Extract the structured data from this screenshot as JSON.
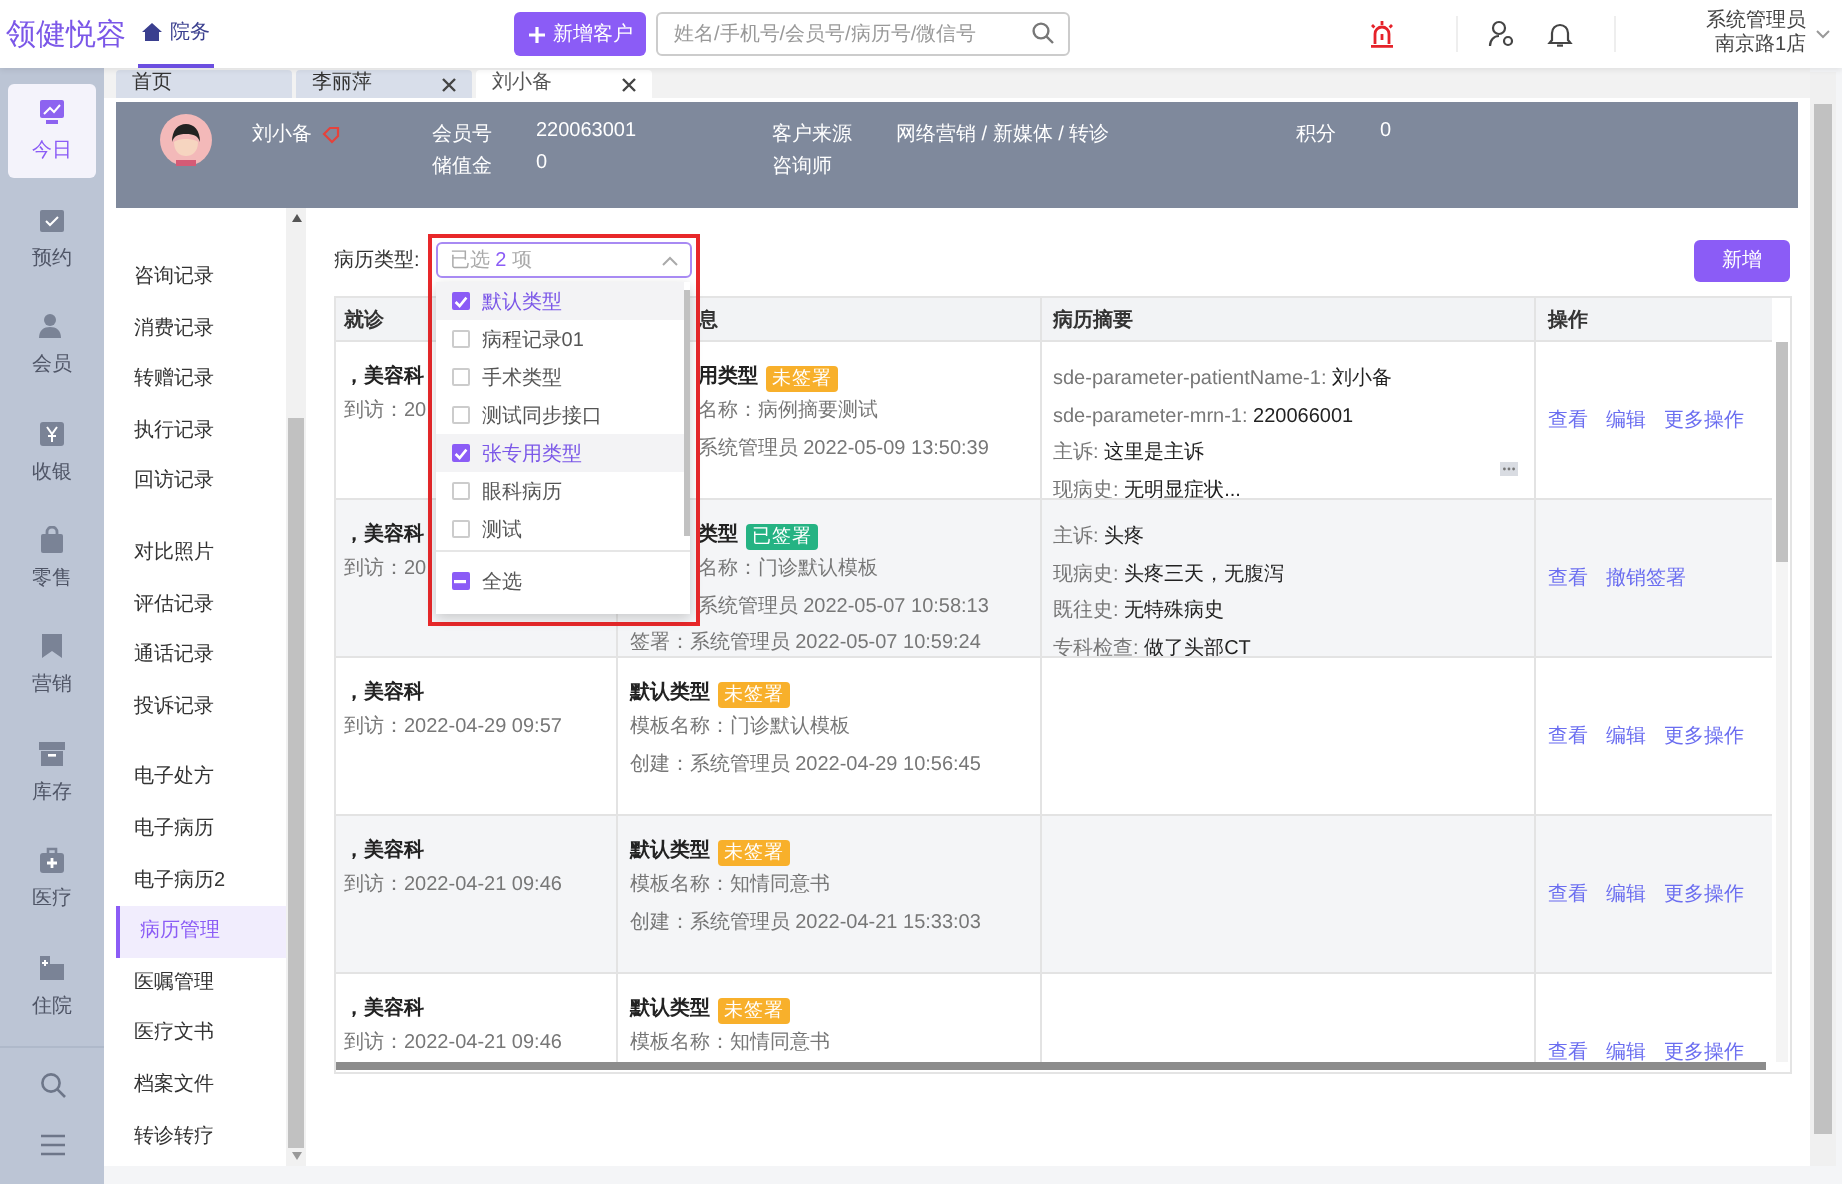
{
  "app": {
    "logo": "领健悦容",
    "section": "院务",
    "add_button": "新增客户",
    "search_placeholder": "姓名/手机号/会员号/病历号/微信号",
    "user": "系统管理员",
    "store": "南京路1店"
  },
  "nav": [
    {
      "label": "今日",
      "selected": true
    },
    {
      "label": "预约",
      "selected": false
    },
    {
      "label": "会员",
      "selected": false
    },
    {
      "label": "收银",
      "selected": false
    },
    {
      "label": "零售",
      "selected": false
    },
    {
      "label": "营销",
      "selected": false
    },
    {
      "label": "库存",
      "selected": false
    },
    {
      "label": "医疗",
      "selected": false
    },
    {
      "label": "住院",
      "selected": false
    }
  ],
  "tabs": [
    {
      "label": "首页",
      "selected": false,
      "closable": false
    },
    {
      "label": "李丽萍",
      "selected": false,
      "closable": true
    },
    {
      "label": "刘小备",
      "selected": true,
      "closable": true
    }
  ],
  "patient": {
    "name": "刘小备",
    "fields": [
      {
        "label": "会员号",
        "value": "220063001"
      },
      {
        "label": "储值金",
        "value": "0"
      },
      {
        "label": "客户来源",
        "value": "网络营销 / 新媒体 / 转诊"
      },
      {
        "label": "咨询师"
      },
      {
        "label": "积分",
        "value": "0"
      }
    ]
  },
  "submenu": [
    {
      "items": [
        {
          "label": "咨询记录",
          "selected": false
        },
        {
          "label": "消费记录",
          "selected": false
        },
        {
          "label": "转赠记录",
          "selected": false
        },
        {
          "label": "执行记录",
          "selected": false
        },
        {
          "label": "回访记录",
          "selected": false
        }
      ]
    },
    {
      "items": [
        {
          "label": "对比照片",
          "selected": false
        },
        {
          "label": "评估记录",
          "selected": false
        },
        {
          "label": "通话记录",
          "selected": false
        },
        {
          "label": "投诉记录",
          "selected": false
        }
      ]
    },
    {
      "items": [
        {
          "label": "电子处方",
          "selected": false
        },
        {
          "label": "电子病历",
          "selected": false
        },
        {
          "label": "电子病历2",
          "selected": false
        },
        {
          "label": "病历管理",
          "selected": true
        },
        {
          "label": "医嘱管理",
          "selected": false
        },
        {
          "label": "医疗文书",
          "selected": false
        },
        {
          "label": "档案文件",
          "selected": false
        },
        {
          "label": "转诊转疗",
          "selected": false
        }
      ]
    }
  ],
  "filter": {
    "label": "病历类型:",
    "summary_prefix": "已选",
    "count": "2",
    "summary_suffix": "项",
    "open": true,
    "highlighted": true,
    "options": [
      {
        "label": "默认类型",
        "checked": true,
        "hovered": true
      },
      {
        "label": "病程记录01",
        "checked": false,
        "hovered": false
      },
      {
        "label": "手术类型",
        "checked": false,
        "hovered": false
      },
      {
        "label": "测试同步接口",
        "checked": false,
        "hovered": false
      },
      {
        "label": "张专用类型",
        "checked": true,
        "hovered": true
      },
      {
        "label": "眼科病历",
        "checked": false,
        "hovered": false
      },
      {
        "label": "测试",
        "checked": false,
        "hovered": false
      }
    ],
    "select_all": {
      "label": "全选",
      "indeterminate": true
    }
  },
  "add_button": "新增",
  "table": {
    "columns": [
      {
        "label": "就诊"
      },
      {
        "label": "息",
        "under_dropdown": true
      },
      {
        "label": "病历摘要"
      },
      {
        "label": "操作"
      }
    ],
    "rows": [
      {
        "dept": "，美容科",
        "time": "到访：20",
        "info": [
          {
            "text": "用类型",
            "tag": {
              "label": "未签署",
              "kind": "unsigned"
            },
            "under_dropdown": true
          },
          {
            "text": "名称：病例摘要测试",
            "under_dropdown": true
          },
          {
            "text": "系统管理员 2022-05-09 13:50:39",
            "under_dropdown": true
          }
        ],
        "summary": [
          {
            "label": "sde-parameter-patientName-1:",
            "value": "刘小备"
          },
          {
            "label": "sde-parameter-mrn-1:",
            "value": "220066001"
          },
          {
            "label": "主诉:",
            "value": "这里是主诉"
          },
          {
            "label": "现病史:",
            "value": "无明显症状..."
          }
        ],
        "summary_more": true,
        "actions": [
          "查看",
          "编辑",
          "更多操作"
        ]
      },
      {
        "dept": "，美容科",
        "time": "到访：20",
        "info": [
          {
            "text": "类型",
            "tag": {
              "label": "已签署",
              "kind": "signed"
            },
            "under_dropdown": true
          },
          {
            "text": "名称：门诊默认模板",
            "under_dropdown": true
          },
          {
            "text": "系统管理员 2022-05-07 10:58:13",
            "under_dropdown": true
          },
          {
            "text": "签署：系统管理员 2022-05-07 10:59:24"
          }
        ],
        "summary": [
          {
            "label": "主诉:",
            "value": "头疼"
          },
          {
            "label": "现病史:",
            "value": "头疼三天，无腹泻"
          },
          {
            "label": "既往史:",
            "value": "无特殊病史"
          },
          {
            "label": "专科检查:",
            "value": "做了头部CT"
          }
        ],
        "actions": [
          "查看",
          "撤销签署"
        ]
      },
      {
        "dept": "，美容科",
        "time": "到访：2022-04-29 09:57",
        "info": [
          {
            "text": "默认类型",
            "tag": {
              "label": "未签署",
              "kind": "unsigned"
            }
          },
          {
            "text": "模板名称：门诊默认模板"
          },
          {
            "text": "创建：系统管理员 2022-04-29 10:56:45"
          }
        ],
        "actions": [
          "查看",
          "编辑",
          "更多操作"
        ]
      },
      {
        "dept": "，美容科",
        "time": "到访：2022-04-21 09:46",
        "info": [
          {
            "text": "默认类型",
            "tag": {
              "label": "未签署",
              "kind": "unsigned"
            }
          },
          {
            "text": "模板名称：知情同意书"
          },
          {
            "text": "创建：系统管理员 2022-04-21 15:33:03"
          }
        ],
        "actions": [
          "查看",
          "编辑",
          "更多操作"
        ]
      },
      {
        "dept": "，美容科",
        "time": "到访：2022-04-21 09:46",
        "info": [
          {
            "text": "默认类型",
            "tag": {
              "label": "未签署",
              "kind": "unsigned"
            }
          },
          {
            "text": "模板名称：知情同意书"
          }
        ],
        "actions": [
          "查看",
          "编辑",
          "更多操作"
        ]
      }
    ]
  }
}
